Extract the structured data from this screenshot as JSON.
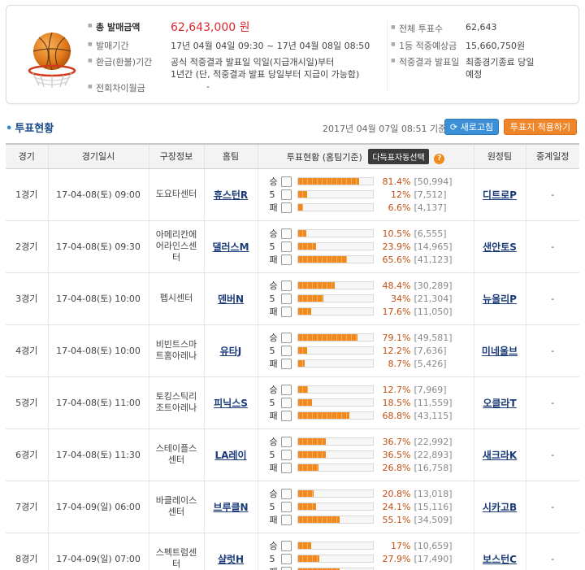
{
  "summary": {
    "total_sales_label": "총 발매금액",
    "total_sales_value": "62,643,000 원",
    "sale_period_label": "발매기간",
    "sale_period_value": "17년 04월 04일 09:30 ~ 17년 04월 08일 08:50",
    "refund_label": "환급(환불)기간",
    "refund_value_line1": "공식 적중결과 발표일 익일(지급개시일)부터",
    "refund_value_line2": "1년간 (단, 적중결과 발표 당일부터 지급이 가능함)",
    "carryover_label": "전회차이월금",
    "carryover_value": "-",
    "total_votes_label": "전체 투표수",
    "total_votes_value": "62,643",
    "first_prize_label": "1등 적중예상금",
    "first_prize_value": "15,660,750원",
    "result_label": "적중결과 발표일",
    "result_value_line1": "최종경기종료 당일",
    "result_value_line2": "예정"
  },
  "section": {
    "title": "투표현황",
    "base_time": "2017년 04월 07일 08:51 기준",
    "refresh_button": "새로고침",
    "apply_button": "투표지 적용하기"
  },
  "table": {
    "headers": {
      "game": "경기",
      "datetime": "경기일시",
      "venue": "구장정보",
      "home": "홈팀",
      "vote": "투표현황 (홈팀기준)",
      "auto_select": "다득표자동선택",
      "help": "?",
      "away": "원정팀",
      "broadcast": "중계일정"
    },
    "vote_labels": [
      "승",
      "5",
      "패"
    ],
    "rows": [
      {
        "game": "1경기",
        "datetime": "17-04-08(토) 09:00",
        "venue": "도요타센터",
        "home": "휴스턴R",
        "away": "디트로P",
        "broadcast": "-",
        "votes": [
          {
            "pct": "81.4%",
            "cnt": "[50,994]",
            "ratio": 0.814
          },
          {
            "pct": "12%",
            "cnt": "[7,512]",
            "ratio": 0.12
          },
          {
            "pct": "6.6%",
            "cnt": "[4,137]",
            "ratio": 0.066
          }
        ]
      },
      {
        "game": "2경기",
        "datetime": "17-04-08(토) 09:30",
        "venue": "아메리칸에어라인스센터",
        "home": "댈러스M",
        "away": "샌안토S",
        "broadcast": "-",
        "votes": [
          {
            "pct": "10.5%",
            "cnt": "[6,555]",
            "ratio": 0.105
          },
          {
            "pct": "23.9%",
            "cnt": "[14,965]",
            "ratio": 0.239
          },
          {
            "pct": "65.6%",
            "cnt": "[41,123]",
            "ratio": 0.656
          }
        ]
      },
      {
        "game": "3경기",
        "datetime": "17-04-08(토) 10:00",
        "venue": "펩시센터",
        "home": "덴버N",
        "away": "뉴올리P",
        "broadcast": "-",
        "votes": [
          {
            "pct": "48.4%",
            "cnt": "[30,289]",
            "ratio": 0.484
          },
          {
            "pct": "34%",
            "cnt": "[21,304]",
            "ratio": 0.34
          },
          {
            "pct": "17.6%",
            "cnt": "[11,050]",
            "ratio": 0.176
          }
        ]
      },
      {
        "game": "4경기",
        "datetime": "17-04-08(토) 10:00",
        "venue": "비빈트스마트홈아레나",
        "home": "유타J",
        "away": "미네울브",
        "broadcast": "-",
        "votes": [
          {
            "pct": "79.1%",
            "cnt": "[49,581]",
            "ratio": 0.791
          },
          {
            "pct": "12.2%",
            "cnt": "[7,636]",
            "ratio": 0.122
          },
          {
            "pct": "8.7%",
            "cnt": "[5,426]",
            "ratio": 0.087
          }
        ]
      },
      {
        "game": "5경기",
        "datetime": "17-04-08(토) 11:00",
        "venue": "토킹스틱리조트아레나",
        "home": "피닉스S",
        "away": "오클라T",
        "broadcast": "-",
        "votes": [
          {
            "pct": "12.7%",
            "cnt": "[7,969]",
            "ratio": 0.127
          },
          {
            "pct": "18.5%",
            "cnt": "[11,559]",
            "ratio": 0.185
          },
          {
            "pct": "68.8%",
            "cnt": "[43,115]",
            "ratio": 0.688
          }
        ]
      },
      {
        "game": "6경기",
        "datetime": "17-04-08(토) 11:30",
        "venue": "스테이플스센터",
        "home": "LA레이",
        "away": "새크라K",
        "broadcast": "-",
        "votes": [
          {
            "pct": "36.7%",
            "cnt": "[22,992]",
            "ratio": 0.367
          },
          {
            "pct": "36.5%",
            "cnt": "[22,893]",
            "ratio": 0.365
          },
          {
            "pct": "26.8%",
            "cnt": "[16,758]",
            "ratio": 0.268
          }
        ]
      },
      {
        "game": "7경기",
        "datetime": "17-04-09(일) 06:00",
        "venue": "바클레이스센터",
        "home": "브루클N",
        "away": "시카고B",
        "broadcast": "-",
        "votes": [
          {
            "pct": "20.8%",
            "cnt": "[13,018]",
            "ratio": 0.208
          },
          {
            "pct": "24.1%",
            "cnt": "[15,116]",
            "ratio": 0.241
          },
          {
            "pct": "55.1%",
            "cnt": "[34,509]",
            "ratio": 0.551
          }
        ]
      },
      {
        "game": "8경기",
        "datetime": "17-04-09(일) 07:00",
        "venue": "스펙트럼센터",
        "home": "샬럿H",
        "away": "보스턴C",
        "broadcast": "-",
        "votes": [
          {
            "pct": "17%",
            "cnt": "[10,659]",
            "ratio": 0.17
          },
          {
            "pct": "27.9%",
            "cnt": "[17,490]",
            "ratio": 0.279
          },
          {
            "pct": "",
            "cnt": "",
            "ratio": 0.55
          }
        ]
      }
    ]
  },
  "icons": {
    "logo": "basketball-hoop-icon",
    "refresh": "refresh-icon"
  },
  "colors": {
    "accent_orange": "#f08a1c",
    "accent_blue": "#3a8fd6",
    "total_red": "#d8282f"
  }
}
